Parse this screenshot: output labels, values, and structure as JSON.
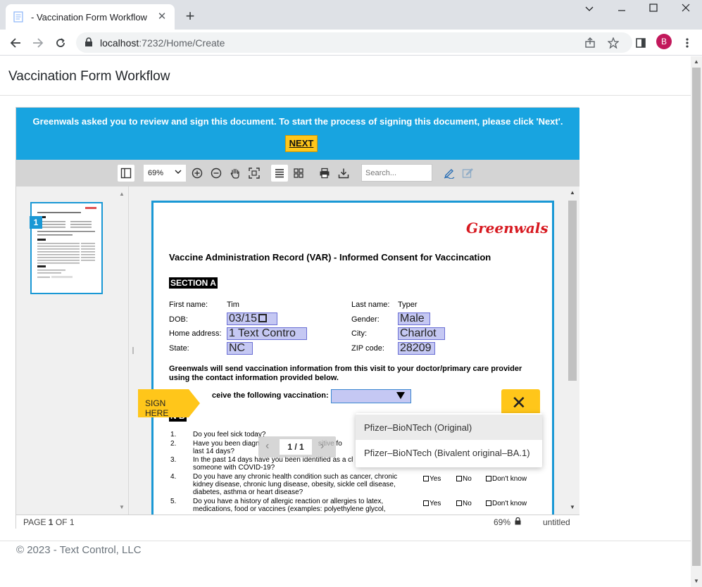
{
  "browser": {
    "tab_title": "- Vaccination Form Workflow",
    "url_host": "localhost",
    "url_rest": ":7232/Home/Create",
    "profile_initial": "B"
  },
  "page": {
    "title": "Vaccination Form Workflow",
    "footer": "© 2023 - Text Control, LLC"
  },
  "viewer": {
    "banner_text": "Greenwals asked you to review and sign this document. To start the process of signing this document, please click 'Next'.",
    "next_label": "NEXT",
    "zoom_value": "69%",
    "search_placeholder": "Search...",
    "thumbnail_number": "1",
    "pager": "1 / 1",
    "status_page_prefix": "PAGE ",
    "status_page_num": "1",
    "status_page_suffix": " OF 1",
    "status_zoom": "69%",
    "status_doc_name": "untitled",
    "sign_here_label": "SIGN HERE"
  },
  "document": {
    "logo": "Greenwals",
    "title": "Vaccine Administration Record (VAR) - Informed Consent for Vaccincation",
    "section_a": "SECTION A",
    "labels": {
      "first_name": "First name:",
      "dob": "DOB:",
      "home_address": "Home address:",
      "state": "State:",
      "last_name": "Last name:",
      "gender": "Gender:",
      "city": "City:",
      "zip": "ZIP code:"
    },
    "values": {
      "first_name": "Tim",
      "dob": "03/15",
      "home_address": "1 Text Contro",
      "state": "NC",
      "last_name": "Typer",
      "gender": "Male",
      "city": "Charlot",
      "zip": "28209"
    },
    "info_paragraph": "Greenwals will send vaccination information from this visit to your doctor/primary care provider using the contact information provided below.",
    "receive_label": "ceive the following vaccination:",
    "section_b": "N B",
    "questions": [
      {
        "num": "1.",
        "text": "Do you feel sick today?"
      },
      {
        "num": "2.",
        "text": "Have you been diagn                              sitive fo\nlast 14 days?"
      },
      {
        "num": "3.",
        "text": "In the past 14 days have you been identified as a cl\nsomeone with COVID-19?"
      },
      {
        "num": "4.",
        "text": "Do you have any chronic health condition such as cancer, chronic kidney disease, chronic lung disease, obesity, sickle cell disease, diabetes, asthma or heart disease?"
      },
      {
        "num": "5.",
        "text": "Do you have a history of allergic reaction or allergies to latex, medications, food or vaccines (examples: polyethylene glycol,"
      }
    ],
    "options": {
      "yes": "Yes",
      "no": "No",
      "dont_know": "Don't know"
    }
  },
  "dropdown_options": [
    "Pfizer–BioNTech (Original)",
    "Pfizer–BioNTech (Bivalent original–BA.1)"
  ],
  "colors": {
    "banner": "#18a4e0",
    "accent_yellow": "#ffc61a",
    "field_fill": "#c5c8f3",
    "logo_red": "#d71920"
  }
}
